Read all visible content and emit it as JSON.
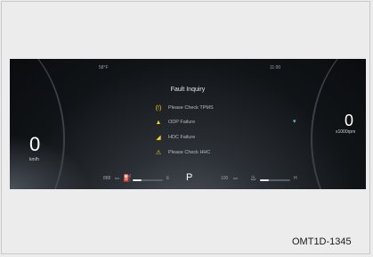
{
  "cluster": {
    "top_left": "58°F",
    "top_right": "11:00",
    "title": "Fault Inquiry",
    "faults": [
      {
        "icon": "tpms-icon",
        "glyph": "(!)",
        "label": "Please Check TPMS"
      },
      {
        "icon": "odp-icon",
        "glyph": "▲",
        "label": "ODP Failure"
      },
      {
        "icon": "hdc-icon",
        "glyph": "◢",
        "label": "HDC Failure"
      },
      {
        "icon": "warning-icon",
        "glyph": "⚠",
        "label": "Please Check HHC"
      }
    ],
    "speed": {
      "value": "0",
      "unit": "km/h"
    },
    "rpm": {
      "value": "0",
      "unit": "x1000rpm"
    },
    "bottom": {
      "left_label": "888",
      "left_unit": "km",
      "left_gauge_min": "E",
      "fuel_level": 0.3,
      "gear": "P",
      "right_label": "100",
      "right_unit": "km",
      "right_gauge_max": "H",
      "temp_level": 0.3
    }
  },
  "caption": "OMT1D-1345"
}
